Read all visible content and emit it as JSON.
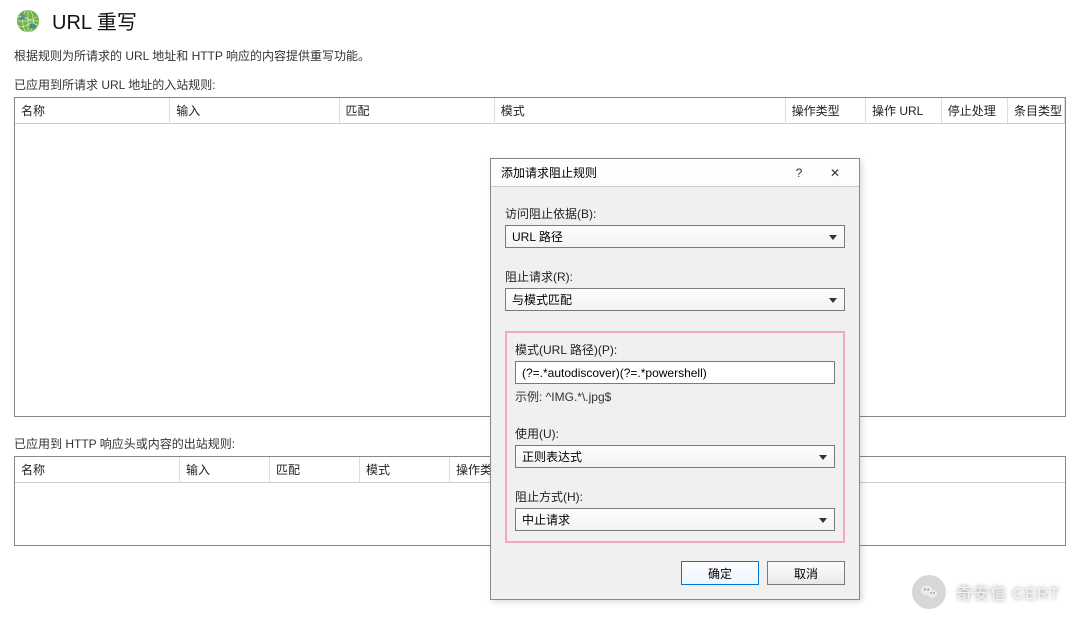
{
  "header": {
    "title": "URL 重写",
    "description": "根据规则为所请求的 URL 地址和 HTTP 响应的内容提供重写功能。"
  },
  "sections": {
    "inbound_label": "已应用到所请求 URL 地址的入站规则:",
    "outbound_label": "已应用到 HTTP 响应头或内容的出站规则:"
  },
  "grid1_columns": [
    "名称",
    "输入",
    "匹配",
    "模式",
    "操作类型",
    "操作 URL",
    "停止处理",
    "条目类型"
  ],
  "grid2_columns": [
    "名称",
    "输入",
    "匹配",
    "模式",
    "操作类"
  ],
  "grid1_col_widths": [
    165,
    180,
    165,
    310,
    85,
    80,
    70,
    60
  ],
  "grid2_col_widths": [
    165,
    90,
    90,
    90,
    50
  ],
  "dialog": {
    "title": "添加请求阻止规则",
    "help_glyph": "?",
    "close_glyph": "✕",
    "block_basis_label": "访问阻止依据(B):",
    "block_basis_value": "URL 路径",
    "block_request_label": "阻止请求(R):",
    "block_request_value": "与模式匹配",
    "pattern_label": "模式(URL 路径)(P):",
    "pattern_value": "(?=.*autodiscover)(?=.*powershell)",
    "example_label": "示例: ^IMG.*\\.jpg$",
    "using_label": "使用(U):",
    "using_value": "正则表达式",
    "block_method_label": "阻止方式(H):",
    "block_method_value": "中止请求",
    "ok_label": "确定",
    "cancel_label": "取消"
  },
  "watermark": {
    "text": "奇安信 CERT"
  }
}
